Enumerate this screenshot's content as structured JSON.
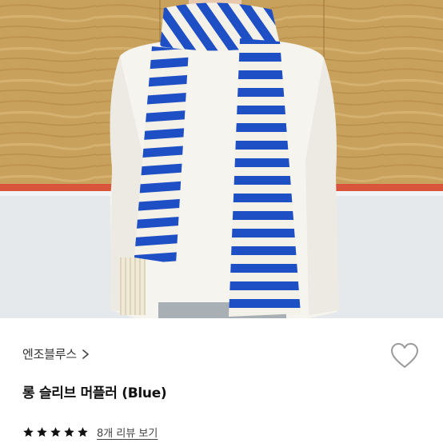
{
  "product": {
    "brand": "엔조블루스",
    "title": "롱 슬리브 머플러 (Blue)",
    "rating_stars": 5,
    "review_link": "8개 리뷰 보기"
  },
  "icons": {
    "brand_chevron": "chevron-right-icon",
    "wishlist": "heart-outline-icon",
    "rating": "star-filled-icon"
  },
  "colors": {
    "scarf_blue": "#1f4fc4",
    "scarf_cream": "#f4f1e8",
    "wood": "#c9a460",
    "heart_stroke": "#9a9a9a",
    "star": "#111111"
  }
}
